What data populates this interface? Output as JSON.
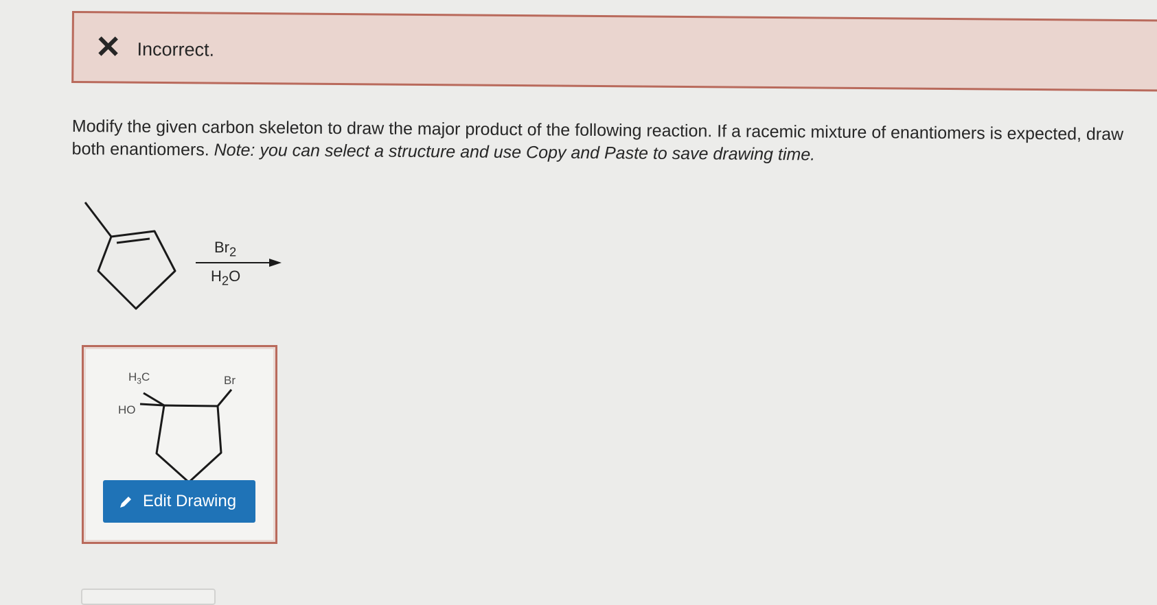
{
  "feedback": {
    "status_text": "Incorrect.",
    "icon": "x-icon",
    "status_color": "#b96a5c"
  },
  "question": {
    "instruction": "Modify the given carbon skeleton to draw the major product of the following reaction. If a racemic mixture of enantiomers is expected, draw both enantiomers.",
    "note": "Note: you can select a structure and use Copy and Paste to save drawing time."
  },
  "reaction": {
    "reagent_top": "Br",
    "reagent_top_sub": "2",
    "reagent_bottom_pre": "H",
    "reagent_bottom_sub": "2",
    "reagent_bottom_post": "O"
  },
  "answer": {
    "label_methyl": "H",
    "label_methyl_sub": "3",
    "label_methyl_post": "C",
    "label_br": "Br",
    "label_oh": "HO",
    "edit_button_label": "Edit Drawing",
    "button_color": "#1f73b7",
    "button_icon": "pencil-icon"
  }
}
